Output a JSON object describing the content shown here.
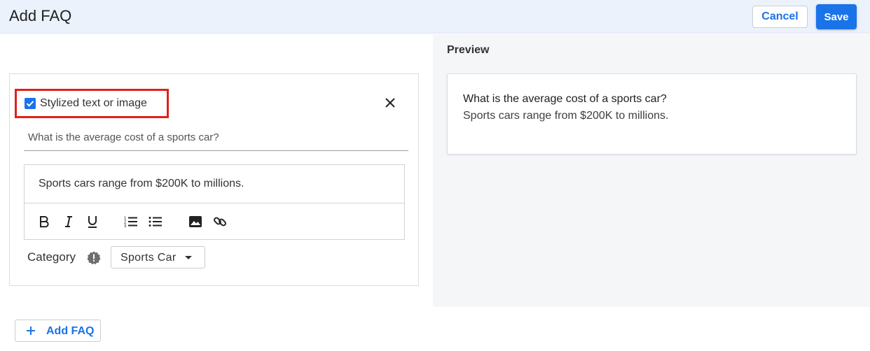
{
  "header": {
    "title": "Add FAQ",
    "cancel_label": "Cancel",
    "save_label": "Save"
  },
  "faq_item": {
    "stylized_checkbox": {
      "label": "Stylized text or image",
      "checked": true
    },
    "question": "What is the average cost of a sports car?",
    "answer": "Sports cars range from $200K to millions.",
    "toolbar": [
      "bold-icon",
      "italic-icon",
      "underline-icon",
      "numbered-list-icon",
      "bulleted-list-icon",
      "image-icon",
      "link-icon"
    ],
    "category_label": "Category",
    "category_value": "Sports Car"
  },
  "preview": {
    "heading": "Preview",
    "question": "What is the average cost of a sports car?",
    "answer": "Sports cars range from $200K to millions."
  },
  "footer": {
    "add_faq_label": "Add FAQ"
  },
  "colors": {
    "accent": "#1a73e8",
    "highlight": "#e0201b",
    "header_bg": "#ecf2fb",
    "preview_bg": "#f5f6f8"
  }
}
